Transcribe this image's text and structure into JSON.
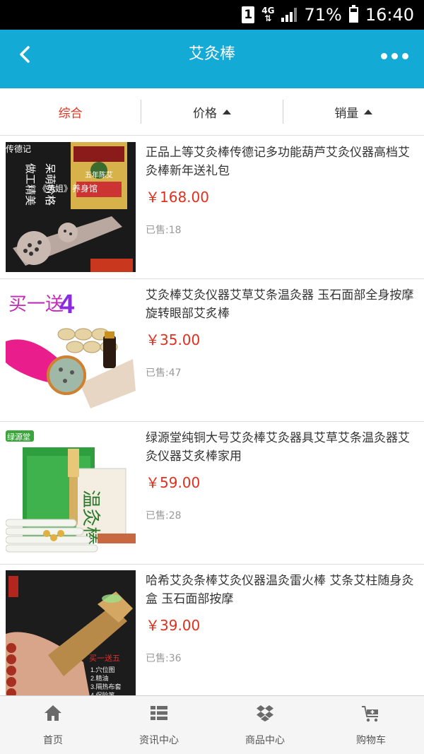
{
  "status_bar": {
    "sim": "1",
    "network": "4G",
    "battery": "71%",
    "battery_level": 0.71,
    "time": "16:40"
  },
  "header": {
    "title": "艾灸棒",
    "back_icon": "chevron-left-icon",
    "more_icon": "more-dots-icon",
    "color": "#14aad6"
  },
  "sort": {
    "items": [
      {
        "label": "综合",
        "active": true
      },
      {
        "label": "价格",
        "icon": "triangle-up-icon"
      },
      {
        "label": "销量",
        "icon": "triangle-up-icon"
      }
    ],
    "active_color": "#e0301e"
  },
  "products": [
    {
      "name": "正品上等艾灸棒传德记多功能葫芦艾灸仪器高档艾灸棒新年送礼包",
      "price": "￥168.00",
      "sold": "已售:18",
      "image_text": [
        "传德记",
        "做工精美",
        "呆萌价格",
        "五年陈艾",
        "《英姐》养身馆"
      ]
    },
    {
      "name": "艾灸棒艾灸仪器艾草艾条温灸器 玉石面部全身按摩旋转眼部艾炙棒",
      "price": "￥35.00",
      "sold": "已售:47",
      "image_text": [
        "买一送",
        "4"
      ]
    },
    {
      "name": "绿源堂纯铜大号艾灸棒艾灸器具艾草艾条温灸器艾灸仪器艾炙棒家用",
      "price": "￥59.00",
      "sold": "已售:28",
      "image_text": [
        "绿源堂",
        "温灸棒"
      ]
    },
    {
      "name": "哈希艾灸条棒艾灸仪器温灸雷火棒 艾条艾柱随身灸盒 玉石面部按摩",
      "price": "￥39.00",
      "sold": "已售:36",
      "image_text": [
        "买一送五"
      ]
    }
  ],
  "tabbar": {
    "items": [
      {
        "label": "首页",
        "icon": "home-icon"
      },
      {
        "label": "资讯中心",
        "icon": "list-icon"
      },
      {
        "label": "商品中心",
        "icon": "dropbox-icon"
      },
      {
        "label": "购物车",
        "icon": "cart-icon"
      }
    ]
  }
}
